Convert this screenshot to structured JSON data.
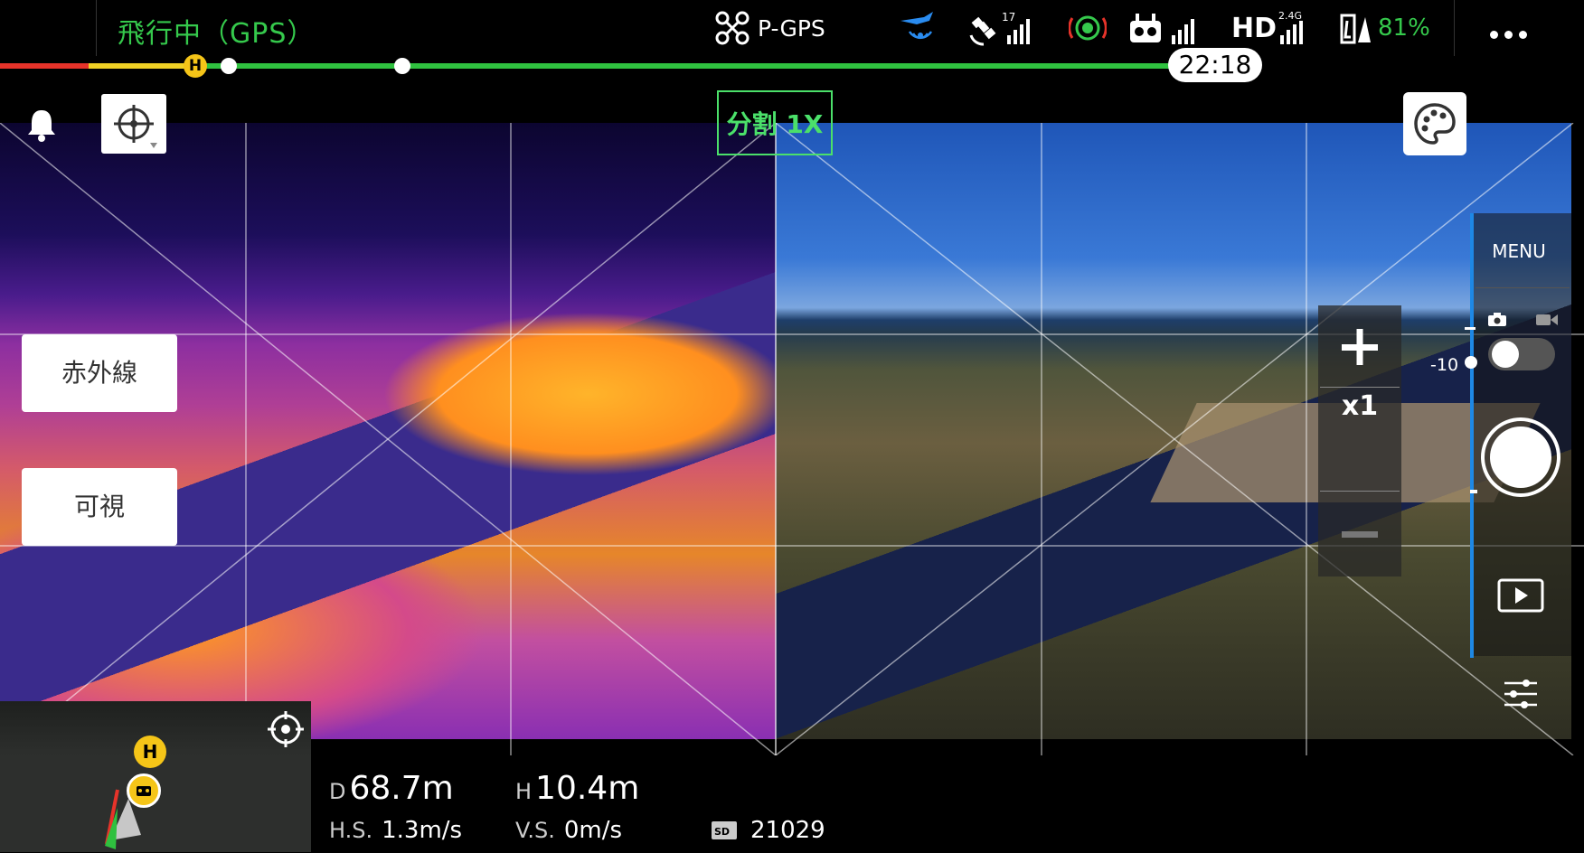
{
  "status_bar": {
    "flight_status": "飛行中（GPS）",
    "flight_mode": "P-GPS",
    "satellite_count": "17",
    "hd_band": "2.4G",
    "hd_label": "HD",
    "battery_percent": "81%",
    "flight_time": "22:18"
  },
  "camera": {
    "split_label": "分割 1X",
    "modes": {
      "infrared_label": "赤外線",
      "visible_label": "可視"
    },
    "zoom_level": "x1",
    "ev_value": "-10"
  },
  "side_panel": {
    "menu_label": "MENU"
  },
  "map": {
    "home_marker": "H"
  },
  "telemetry": {
    "distance_prefix": "D",
    "distance_value": "68.7m",
    "height_prefix": "H",
    "height_value": "10.4m",
    "hs_label": "H.S.",
    "hs_value": "1.3m/s",
    "vs_label": "V.S.",
    "vs_value": "0m/s",
    "sd_label": "SD",
    "sd_remaining": "21029"
  },
  "colors": {
    "status_green": "#35c94c",
    "accent_blue": "#1e88e5",
    "home_yellow": "#f5c518",
    "bar_red": "#e6332a",
    "bar_yellow": "#f0d125",
    "bar_green": "#2fc13f"
  }
}
